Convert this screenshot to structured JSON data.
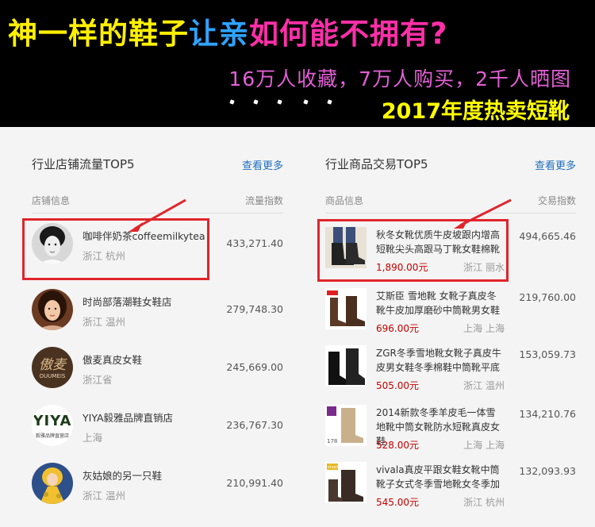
{
  "banner": {
    "headline_part1": "神一样的鞋子",
    "headline_part2": "让亲",
    "headline_part3": "如何能不拥有?",
    "subline": "16万人收藏，7万人购买，2千人晒图",
    "year_tag": "2017年度热卖短靴"
  },
  "stores_panel": {
    "title": "行业店铺流量TOP5",
    "more_label": "查看更多",
    "col_info": "店铺信息",
    "col_metric": "流量指数",
    "items": [
      {
        "name": "咖啡伴奶茶coffeemilkytea",
        "location": "浙江 杭州",
        "value": "433,271.40"
      },
      {
        "name": "时尚部落潮鞋女鞋店",
        "location": "浙江 温州",
        "value": "279,748.30"
      },
      {
        "name": "傲麦真皮女鞋",
        "location": "浙江省",
        "value": "245,669.00",
        "logo_text": "傲麦",
        "logo_sub": "OUUMEIS"
      },
      {
        "name": "YIYA毅雅品牌直销店",
        "location": "上海",
        "value": "236,767.30",
        "logo_text": "YIYA",
        "logo_sub": "毅雅品牌直营店"
      },
      {
        "name": "灰姑娘的另一只鞋",
        "location": "浙江 温州",
        "value": "210,991.40"
      }
    ]
  },
  "products_panel": {
    "title": "行业商品交易TOP5",
    "more_label": "查看更多",
    "col_info": "商品信息",
    "col_metric": "交易指数",
    "items": [
      {
        "title": "秋冬女靴优质牛皮坡跟内增高短靴尖头高跟马丁靴女鞋棉靴",
        "price": "1,890.00元",
        "location": "浙江 丽水",
        "value": "494,665.46"
      },
      {
        "title": "艾斯臣 雪地靴 女靴子真皮冬靴牛皮加厚磨砂中筒靴男女鞋",
        "price": "696.00元",
        "location": "上海 上海",
        "value": "219,760.00"
      },
      {
        "title": "ZGR冬季雪地靴女靴子真皮牛皮男女鞋冬季棉鞋中筒靴平底",
        "price": "505.00元",
        "location": "浙江 温州",
        "value": "153,059.73"
      },
      {
        "title": "2014新款冬季羊皮毛一体雪地靴中筒女靴防水短靴真皮女鞋",
        "price": "528.00元",
        "location": "上海 上海",
        "value": "134,210.76",
        "thumb_tag": "178"
      },
      {
        "title": "vivala真皮平跟女鞋女靴中筒靴子女式冬季雪地靴女冬季加",
        "price": "545.00元",
        "location": "浙江 杭州",
        "value": "132,093.93",
        "thumb_tag": "vivala"
      }
    ]
  },
  "colors": {
    "highlight": "#e0252b",
    "link": "#1e6fbf",
    "price": "#c40000"
  }
}
